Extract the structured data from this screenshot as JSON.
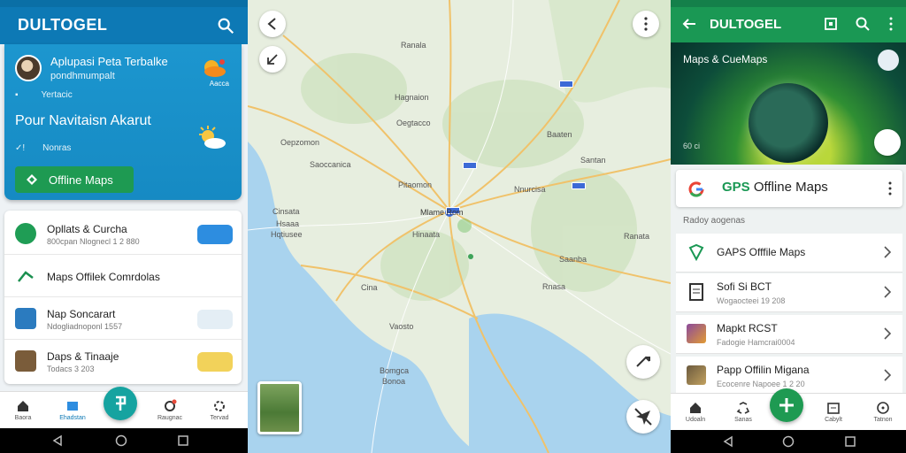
{
  "left": {
    "app_title": "DULTOGEL",
    "hero": {
      "title": "Aplupasi Peta Terbalke",
      "subtitle": "pondhmumpalt",
      "small_label": "Yertacic",
      "weather_label": "Aacca",
      "heading": "Pour Navitaisn Akarut",
      "small_label2": "Nonras",
      "button_label": "Offline Maps"
    },
    "list": [
      {
        "title": "Opllats & Curcha",
        "subtitle": "800cpan Nlognecl 1 2 880",
        "color": "#1f9d55"
      },
      {
        "title": "Maps Offilek Comrdolas",
        "subtitle": "",
        "color": "#1a8f4f"
      },
      {
        "title": "Nap Soncarart",
        "subtitle": "Ndogliadnoponl 1557",
        "color": "#2b7bbf"
      },
      {
        "title": "Daps & Tinaaje",
        "subtitle": "Todacs 3 203",
        "color": "#7a5c3a"
      }
    ],
    "nav": [
      "Baora",
      "Ehadstan",
      "",
      "Raugnac",
      "Tervad"
    ]
  },
  "map": {
    "labels": [
      "Ranala",
      "Hagnaion",
      "Oegtacco",
      "Oepzomon",
      "Baaten",
      "Saoccanica",
      "Santan",
      "Pitaomon",
      "Nnurcisa",
      "Cinsata",
      "Hsaaa",
      "Hqtiusee",
      "Hinaata",
      "Ranata",
      "Saanba",
      "Cina",
      "Rnasa",
      "Bomgca",
      "Bonoa",
      "Mlame Rom",
      "Vaosto"
    ]
  },
  "right": {
    "app_title": "DULTOGEL",
    "banner_title": "Maps & CueMaps",
    "banner_sub": "60 ci",
    "search_accent": "GPS",
    "search_label": "Offline Maps",
    "section": "Radoy aogenas",
    "items": [
      {
        "title": "GAPS Offfile Maps",
        "subtitle": ""
      },
      {
        "title": "Sofi Si BCT",
        "subtitle": "Wogaocteei 19 208"
      },
      {
        "title": "Mapkt RCST",
        "subtitle": "Fadogie Hamcrai0004"
      },
      {
        "title": "Papp Offilin Migana",
        "subtitle": "Ecocenre Napoee 1 2 20"
      }
    ],
    "nav": [
      "Udoaln",
      "Sanas",
      "",
      "Cabylt",
      "Tatnon"
    ]
  },
  "colors": {
    "left_primary": "#0d79b5",
    "right_primary": "#1a9854",
    "accent_green": "#1e9a52",
    "fab_teal": "#16a3a0"
  }
}
